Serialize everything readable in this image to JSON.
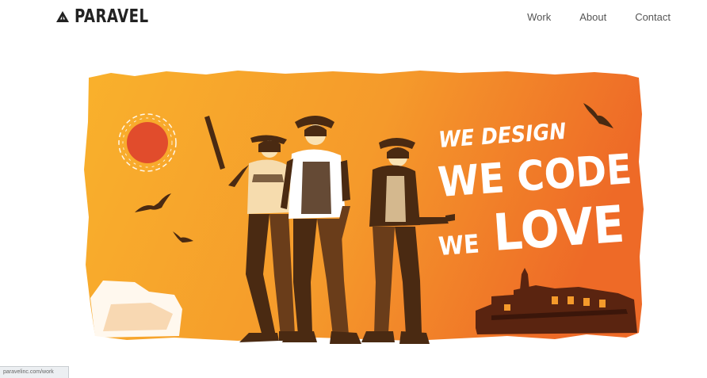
{
  "site": {
    "logo_text": "PARAVEL",
    "logo_icon": "triangle-logo-icon"
  },
  "nav": {
    "items": [
      {
        "label": "Work"
      },
      {
        "label": "About"
      },
      {
        "label": "Contact"
      }
    ]
  },
  "hero": {
    "line1": "WE DESIGN",
    "line2": "WE CODE",
    "line3a": "WE",
    "line3b": "LOVE",
    "colors": {
      "gradient_start": "#f9b12c",
      "gradient_end": "#ee6a27",
      "sun": "#e14c2c",
      "figures": "#4a2a12",
      "text": "#ffffff"
    }
  },
  "status_bar": {
    "url": "paravelinc.com/work"
  }
}
